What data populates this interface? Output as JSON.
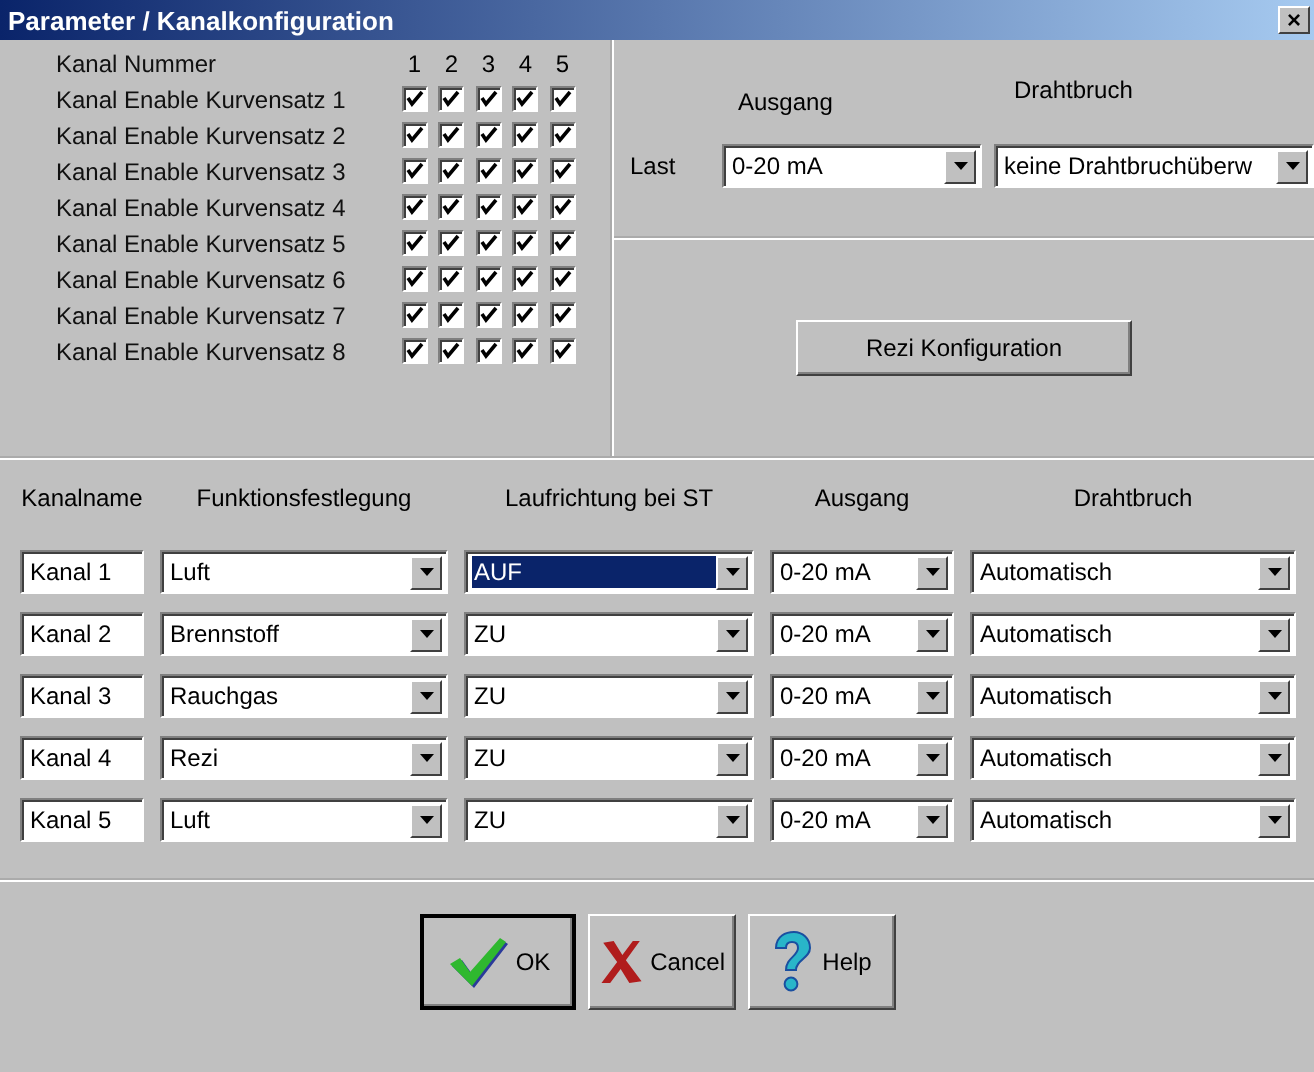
{
  "window": {
    "title": "Parameter / Kanalkonfiguration",
    "close": "×"
  },
  "enable": {
    "header_label": "Kanal Nummer",
    "channels": [
      "1",
      "2",
      "3",
      "4",
      "5"
    ],
    "rows": [
      {
        "label": "Kanal Enable Kurvensatz 1",
        "checked": [
          true,
          true,
          true,
          true,
          true
        ]
      },
      {
        "label": "Kanal Enable Kurvensatz 2",
        "checked": [
          true,
          true,
          true,
          true,
          true
        ]
      },
      {
        "label": "Kanal Enable Kurvensatz 3",
        "checked": [
          true,
          true,
          true,
          true,
          true
        ]
      },
      {
        "label": "Kanal Enable Kurvensatz 4",
        "checked": [
          true,
          true,
          true,
          true,
          true
        ]
      },
      {
        "label": "Kanal Enable Kurvensatz 5",
        "checked": [
          true,
          true,
          true,
          true,
          true
        ]
      },
      {
        "label": "Kanal Enable Kurvensatz 6",
        "checked": [
          true,
          true,
          true,
          true,
          true
        ]
      },
      {
        "label": "Kanal Enable Kurvensatz 7",
        "checked": [
          true,
          true,
          true,
          true,
          true
        ]
      },
      {
        "label": "Kanal Enable Kurvensatz 8",
        "checked": [
          true,
          true,
          true,
          true,
          true
        ]
      }
    ]
  },
  "last": {
    "label": "Last",
    "ausgang_label": "Ausgang",
    "drahtbruch_label": "Drahtbruch",
    "ausgang": "0-20 mA",
    "drahtbruch": "keine Drahtbruchüberw"
  },
  "rezi_button": "Rezi Konfiguration",
  "table": {
    "columns": [
      "Kanalname",
      "Funktionsfestlegung",
      "Laufrichtung bei ST",
      "Ausgang",
      "Drahtbruch"
    ],
    "rows": [
      {
        "name": "Kanal 1",
        "funktion": "Luft",
        "laufrichtung": {
          "value": "AUF",
          "highlighted": true
        },
        "ausgang": "0-20 mA",
        "drahtbruch": "Automatisch"
      },
      {
        "name": "Kanal 2",
        "funktion": "Brennstoff",
        "laufrichtung": {
          "value": "ZU",
          "highlighted": false
        },
        "ausgang": "0-20 mA",
        "drahtbruch": "Automatisch"
      },
      {
        "name": "Kanal 3",
        "funktion": "Rauchgas",
        "laufrichtung": {
          "value": "ZU",
          "highlighted": false
        },
        "ausgang": "0-20 mA",
        "drahtbruch": "Automatisch"
      },
      {
        "name": "Kanal 4",
        "funktion": "Rezi",
        "laufrichtung": {
          "value": "ZU",
          "highlighted": false
        },
        "ausgang": "0-20 mA",
        "drahtbruch": "Automatisch"
      },
      {
        "name": "Kanal 5",
        "funktion": "Luft",
        "laufrichtung": {
          "value": "ZU",
          "highlighted": false
        },
        "ausgang": "0-20 mA",
        "drahtbruch": "Automatisch"
      }
    ]
  },
  "buttons": [
    {
      "kind": "ok",
      "label": "OK",
      "default": true
    },
    {
      "kind": "cancel",
      "label": "Cancel",
      "default": false
    },
    {
      "kind": "help",
      "label": "Help",
      "default": false
    }
  ]
}
